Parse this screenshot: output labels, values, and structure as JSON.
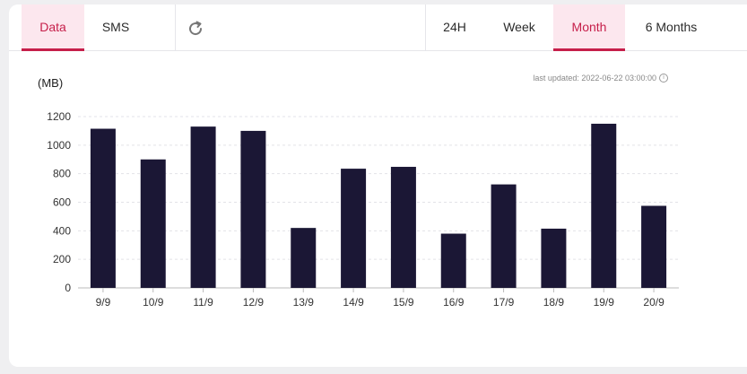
{
  "tabs_left": [
    {
      "label": "Data",
      "active": true
    },
    {
      "label": "SMS",
      "active": false
    }
  ],
  "tabs_range": [
    {
      "label": "24H",
      "active": false
    },
    {
      "label": "Week",
      "active": false
    },
    {
      "label": "Month",
      "active": true
    },
    {
      "label": "6 Months",
      "active": false
    }
  ],
  "last_updated": "last updated: 2022-06-22 03:00:00",
  "colors": {
    "bar": "#1b1735",
    "accent": "#c61f4a"
  },
  "chart_data": {
    "type": "bar",
    "ylabel": "(MB)",
    "categories": [
      "9/9",
      "10/9",
      "11/9",
      "12/9",
      "13/9",
      "14/9",
      "15/9",
      "16/9",
      "17/9",
      "18/9",
      "19/9",
      "20/9"
    ],
    "values": [
      1115,
      900,
      1130,
      1100,
      420,
      835,
      848,
      380,
      725,
      415,
      1150,
      575
    ],
    "ylim": [
      0,
      1200
    ],
    "yticks": [
      0,
      200,
      400,
      600,
      800,
      1000,
      1200
    ],
    "grid": true
  }
}
